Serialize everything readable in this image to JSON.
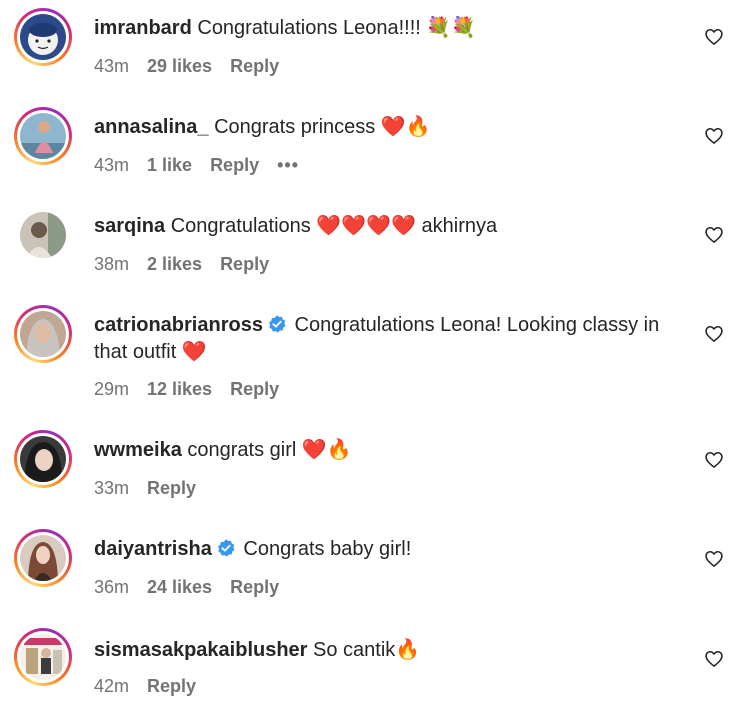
{
  "comments": [
    {
      "username": "imranbard",
      "text": " Congratulations Leona!!!! 💐💐",
      "time": "43m",
      "likes": "29 likes",
      "reply": "Reply",
      "more": ""
    },
    {
      "username": "annasalina_",
      "text": " Congrats princess ❤️🔥",
      "time": "43m",
      "likes": "1 like",
      "reply": "Reply",
      "more": "•••"
    },
    {
      "username": "sarqina",
      "text": " Congratulations ❤️❤️❤️❤️ akhirnya",
      "time": "38m",
      "likes": "2 likes",
      "reply": "Reply",
      "more": ""
    },
    {
      "username": "catrionabrianross",
      "text": " Congratulations Leona! Looking classy in that outfit ❤️",
      "time": "29m",
      "likes": "12 likes",
      "reply": "Reply",
      "more": ""
    },
    {
      "username": "wwmeika",
      "text": " congrats girl ❤️🔥",
      "time": "33m",
      "likes": "",
      "reply": "Reply",
      "more": ""
    },
    {
      "username": "daiyantrisha",
      "text": " Congrats baby girl!",
      "time": "36m",
      "likes": "24 likes",
      "reply": "Reply",
      "more": ""
    },
    {
      "username": "sismasakpakaiblusher",
      "text": " So cantik🔥",
      "time": "42m",
      "likes": "",
      "reply": "Reply",
      "more": ""
    }
  ],
  "icons": {
    "like": "heart-outline-icon",
    "verified": "verified-badge-icon",
    "more": "more-options-icon"
  },
  "colors": {
    "text": "#262626",
    "secondary": "#737373",
    "verified": "#3897f0"
  }
}
